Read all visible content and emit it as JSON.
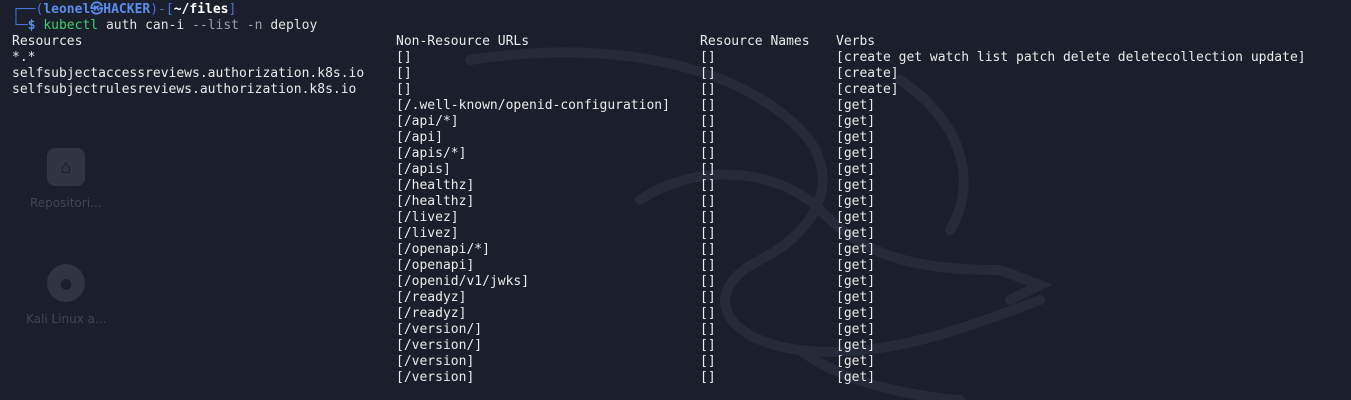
{
  "prompt": {
    "box_open": "┌──(",
    "user": "leonel㉿HACKER",
    "box_mid": ")-[",
    "path": "~/files",
    "box_close": "]",
    "box_bottom": "└─",
    "dollar": "$",
    "cmd": "kubectl",
    "args": "auth can-i",
    "flag": "--list",
    "flag2": "-n",
    "namespace": "deploy"
  },
  "headers": [
    "Resources",
    "Non-Resource URLs",
    "Resource Names",
    "Verbs"
  ],
  "rows": [
    [
      "*.*",
      "[]",
      "[]",
      "[create get watch list patch delete deletecollection update]"
    ],
    [
      "selfsubjectaccessreviews.authorization.k8s.io",
      "[]",
      "[]",
      "[create]"
    ],
    [
      "selfsubjectrulesreviews.authorization.k8s.io",
      "[]",
      "[]",
      "[create]"
    ],
    [
      "",
      "[/.well-known/openid-configuration]",
      "[]",
      "[get]"
    ],
    [
      "",
      "[/api/*]",
      "[]",
      "[get]"
    ],
    [
      "",
      "[/api]",
      "[]",
      "[get]"
    ],
    [
      "",
      "[/apis/*]",
      "[]",
      "[get]"
    ],
    [
      "",
      "[/apis]",
      "[]",
      "[get]"
    ],
    [
      "",
      "[/healthz]",
      "[]",
      "[get]"
    ],
    [
      "",
      "[/healthz]",
      "[]",
      "[get]"
    ],
    [
      "",
      "[/livez]",
      "[]",
      "[get]"
    ],
    [
      "",
      "[/livez]",
      "[]",
      "[get]"
    ],
    [
      "",
      "[/openapi/*]",
      "[]",
      "[get]"
    ],
    [
      "",
      "[/openapi]",
      "[]",
      "[get]"
    ],
    [
      "",
      "[/openid/v1/jwks]",
      "[]",
      "[get]"
    ],
    [
      "",
      "[/readyz]",
      "[]",
      "[get]"
    ],
    [
      "",
      "[/readyz]",
      "[]",
      "[get]"
    ],
    [
      "",
      "[/version/]",
      "[]",
      "[get]"
    ],
    [
      "",
      "[/version/]",
      "[]",
      "[get]"
    ],
    [
      "",
      "[/version]",
      "[]",
      "[get]"
    ],
    [
      "",
      "[/version]",
      "[]",
      "[get]"
    ]
  ],
  "desktop_icons": [
    {
      "label": "Repositori...",
      "icon": "home-icon"
    },
    {
      "label": "Kali Linux a...",
      "icon": "disc-icon"
    }
  ],
  "colors": {
    "background": "#1b1f2b",
    "prompt_blue": "#5a8dee",
    "command_green": "#3bd16f",
    "text": "#eaeaea"
  }
}
